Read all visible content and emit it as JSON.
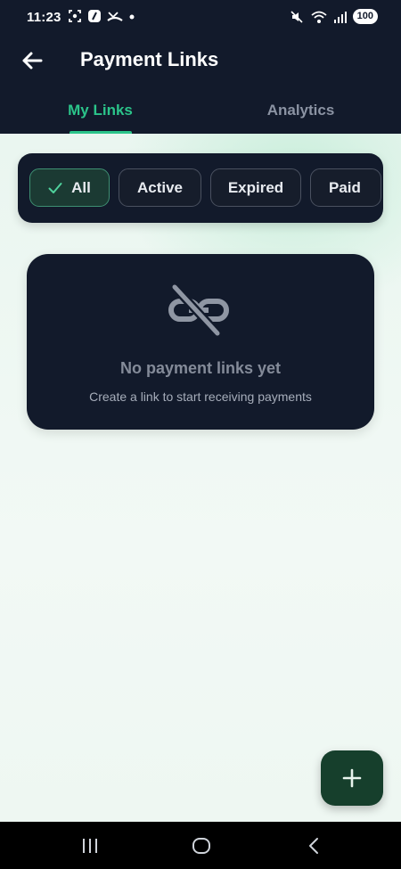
{
  "status_bar": {
    "time": "11:23",
    "battery": "100",
    "icons_left": [
      "screenshot-icon",
      "app-icon",
      "missed-call-icon",
      "dot-icon"
    ],
    "icons_right": [
      "mute-icon",
      "wifi-icon",
      "signal-icon",
      "battery-icon"
    ]
  },
  "header": {
    "title": "Payment Links",
    "back_icon": "arrow-left-icon"
  },
  "tabs": [
    {
      "label": "My Links",
      "active": true
    },
    {
      "label": "Analytics",
      "active": false
    }
  ],
  "filters": [
    {
      "label": "All",
      "selected": true
    },
    {
      "label": "Active",
      "selected": false
    },
    {
      "label": "Expired",
      "selected": false
    },
    {
      "label": "Paid",
      "selected": false
    }
  ],
  "empty_state": {
    "icon": "link-off-icon",
    "title": "No payment links yet",
    "subtitle": "Create a link to start receiving payments"
  },
  "fab": {
    "icon": "plus-icon"
  },
  "nav": {
    "recents": "recents-icon",
    "home": "home-icon",
    "back": "back-icon"
  },
  "colors": {
    "header_bg": "#121a2b",
    "accent": "#2bc48a",
    "fab_bg": "#163f2c",
    "body_bg": "#eef6f2"
  }
}
